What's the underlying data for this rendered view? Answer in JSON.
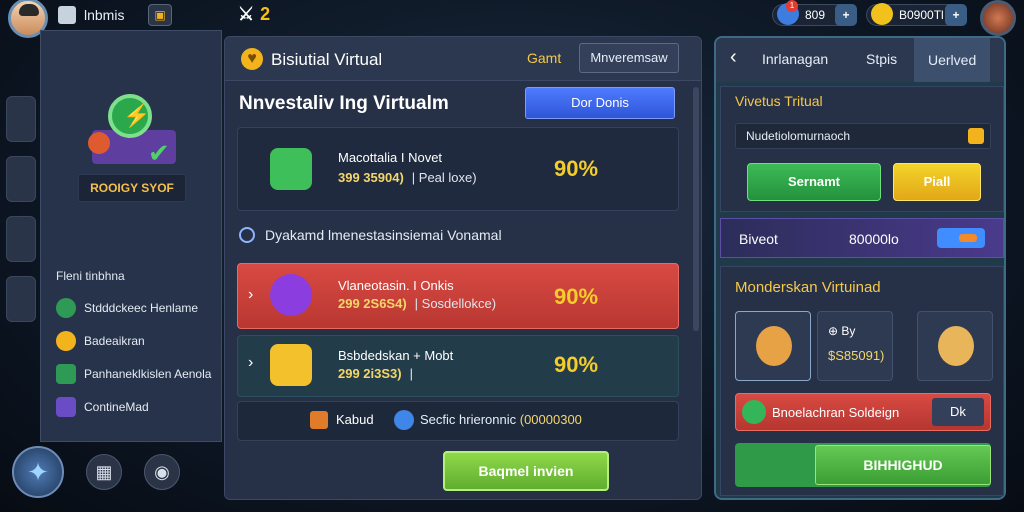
{
  "topbar": {
    "title": "lnbmis",
    "level": "2",
    "resource1": "809",
    "resource2": "B0900Tl",
    "notif": "1",
    "plus": "+"
  },
  "left": {
    "promo_label": "ROOIGY SYOF",
    "section_title": "Fleni tinbhna",
    "items": [
      {
        "label": "Stdddckeec Henlame",
        "color": "#2f9a55"
      },
      {
        "label": "Badeaikran",
        "color": "#f2b31c"
      },
      {
        "label": "Panhaneklkislen Aenola",
        "color": "#2f9a55"
      },
      {
        "label": "ContineMad",
        "color": "#6a4cc4"
      }
    ]
  },
  "center": {
    "header_title": "Bisiutial Virtual",
    "header_link": "Gamt",
    "header_button": "Mnveremsaw",
    "main_title": "Nnvestaliv Ing Virtualm",
    "blue_button": "Dor Donis",
    "cards": [
      {
        "line1": "Macottalia I Novet",
        "line2a": "399 35904)",
        "line2b": "| Peal loxe)",
        "pct": "90%",
        "icon_color": "#3fbf5a"
      },
      {
        "line1": "Vlaneotasin. I Onkis",
        "line2a": "299 2S6S4)",
        "line2b": "| Sosdellokce)",
        "pct": "90%",
        "icon_color": "#8b3de0"
      },
      {
        "line1": "Bsbdedskan + Mobt",
        "line2a": "299 2i3S3)",
        "line2b": "|",
        "pct": "90%",
        "icon_color": "#f2c12c"
      }
    ],
    "subhead": "Dyakamd lmenestasinsiemai Vonamal",
    "strip_a": "Kabud",
    "strip_b": "Secfic hrieronnic",
    "strip_c": "(00000300",
    "green_button": "Baqmel invien"
  },
  "right": {
    "tabs": [
      "Inrlanagan",
      "Stpis",
      "Uerlved"
    ],
    "box1_title": "Vivetus Tritual",
    "box1_input": "Nudetiolomurnaoch",
    "btn_green": "Sernamt",
    "btn_yellow": "Piall",
    "purple_a": "Biveot",
    "purple_b": "80000lo",
    "box2_title": "Monderskan Virtuinad",
    "slot_label": "By",
    "slot_value": "$S85091)",
    "red_label": "Bnoelachran Soldeign",
    "red_btn": "Dk",
    "green_btn": "BIHHIGHUD"
  }
}
